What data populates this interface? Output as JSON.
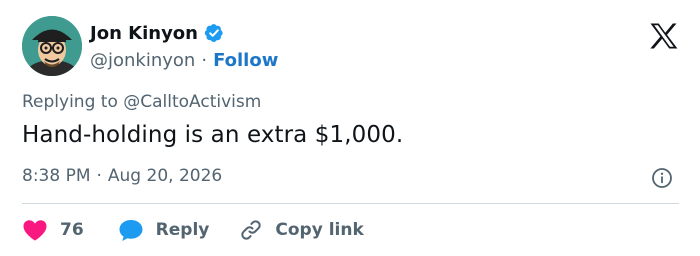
{
  "tweet": {
    "author": {
      "display_name": "Jon Kinyon",
      "handle": "@jonkinyon",
      "separator": "·",
      "follow_label": "Follow",
      "verified": true
    },
    "replying_to": "Replying to @CalltoActivism",
    "text": "Hand-holding is an extra $1,000.",
    "time": "8:38 PM",
    "time_separator": "·",
    "date": "Aug 20, 2026",
    "actions": {
      "likes_count": "76",
      "reply_label": "Reply",
      "copy_link_label": "Copy link"
    }
  },
  "icons": {
    "brand": "x-logo-icon",
    "verified": "verified-badge-icon",
    "info": "info-icon",
    "like": "heart-icon",
    "reply": "reply-bubble-icon",
    "copy": "link-icon"
  },
  "colors": {
    "text_primary": "#0f1419",
    "text_secondary": "#536471",
    "link_blue": "#1d77c9",
    "verified_blue": "#1d9bf0",
    "heart_red": "#f91880",
    "divider": "#cfd9de"
  }
}
